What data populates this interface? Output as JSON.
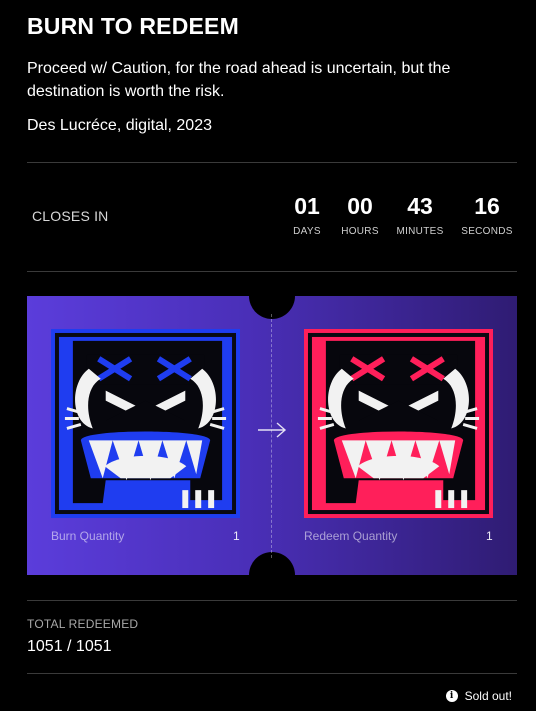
{
  "header": {
    "title": "BURN TO REDEEM",
    "description": "Proceed w/ Caution, for the road ahead is uncertain, but the destination is worth the risk.",
    "credit": "Des Lucréce, digital, 2023"
  },
  "countdown": {
    "label": "CLOSES IN",
    "units": [
      {
        "value": "01",
        "label": "DAYS"
      },
      {
        "value": "00",
        "label": "HOURS"
      },
      {
        "value": "43",
        "label": "MINUTES"
      },
      {
        "value": "16",
        "label": "SECONDS"
      }
    ]
  },
  "ticket": {
    "burn": {
      "label": "Burn Quantity",
      "quantity": "1",
      "art_color": "#1f3df0",
      "art_icon": "monster-head-blue-icon"
    },
    "redeem": {
      "label": "Redeem Quantity",
      "quantity": "1",
      "art_color": "#ff1f5a",
      "art_icon": "monster-head-red-icon"
    },
    "arrow_icon": "arrow-right-icon"
  },
  "total": {
    "label": "TOTAL REDEEMED",
    "value": "1051 / 1051"
  },
  "status": {
    "icon": "info-icon",
    "text": "Sold out!"
  },
  "colors": {
    "background": "#000000",
    "ticket_gradient_start": "#5b3ddb",
    "ticket_gradient_end": "#2f1c73",
    "divider": "#3a3a3a"
  }
}
